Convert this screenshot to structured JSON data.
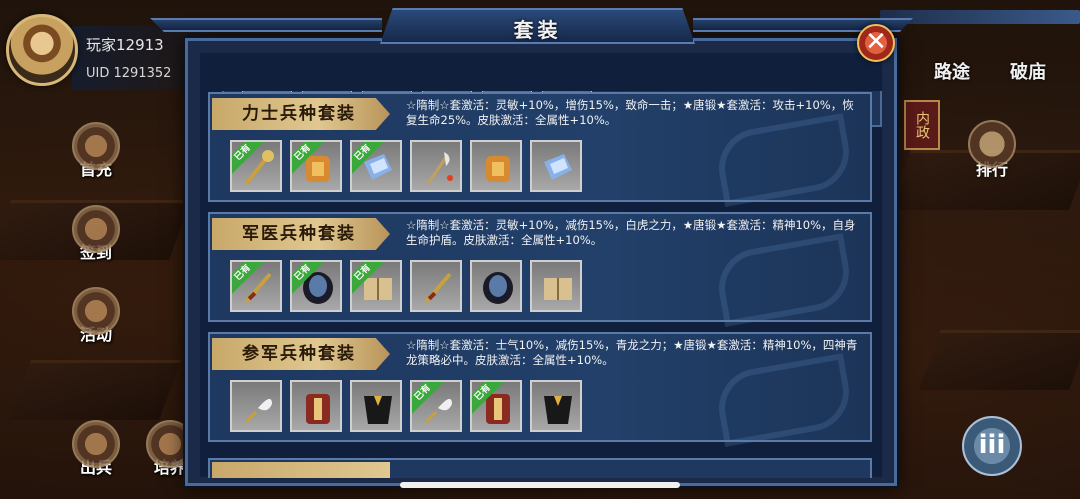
{
  "player": {
    "name": "玩家12913",
    "uid": "UID 1291352"
  },
  "left_menu": [
    {
      "label": "首充",
      "icon": "gift-icon"
    },
    {
      "label": "签到",
      "icon": "calendar-icon"
    },
    {
      "label": "活动",
      "icon": "event-icon"
    },
    {
      "label": "出兵",
      "icon": "army-icon"
    },
    {
      "label": "培养",
      "icon": "cultivate-icon"
    }
  ],
  "right_tabs": {
    "lutu": "路途",
    "pomiao": "破庙",
    "neizheng": "内政",
    "paihang": "排行",
    "menu": "iii"
  },
  "dialog": {
    "title": "套装",
    "close": "✕"
  },
  "owned_label": "已有",
  "sets": [
    {
      "name": "力士兵种套装",
      "desc": "☆隋制☆套激活：灵敏+10%，增伤15%，致命一击；★唐锻★套激活：攻击+10%，恢复生命25%。皮肤激活：全属性+10%。",
      "items": [
        {
          "icon": "mace-icon",
          "owned": true
        },
        {
          "icon": "armor-icon",
          "owned": true
        },
        {
          "icon": "scroll-icon",
          "owned": true
        },
        {
          "icon": "polearm-icon",
          "owned": false
        },
        {
          "icon": "armor-icon",
          "owned": false
        },
        {
          "icon": "scroll-icon",
          "owned": false
        }
      ]
    },
    {
      "name": "军医兵种套装",
      "desc": "☆隋制☆套激活：灵敏+10%，减伤15%，白虎之力，★唐锻★套激活：精神10%，自身生命护盾。皮肤激活：全属性+10%。",
      "items": [
        {
          "icon": "sword-icon",
          "owned": true
        },
        {
          "icon": "cloak-icon",
          "owned": true
        },
        {
          "icon": "book-icon",
          "owned": true
        },
        {
          "icon": "sword-icon",
          "owned": false
        },
        {
          "icon": "cloak-icon",
          "owned": false
        },
        {
          "icon": "book-icon",
          "owned": false
        }
      ]
    },
    {
      "name": "参军兵种套装",
      "desc": "☆隋制☆套激活：士气10%，减伤15%，青龙之力；★唐锻★套激活：精神10%，四神青龙策略必中。皮肤激活：全属性+10%。",
      "items": [
        {
          "icon": "feather-fan-icon",
          "owned": false
        },
        {
          "icon": "robe-icon",
          "owned": false
        },
        {
          "icon": "cape-icon",
          "owned": false
        },
        {
          "icon": "feather-fan-icon",
          "owned": true
        },
        {
          "icon": "robe-icon",
          "owned": true
        },
        {
          "icon": "cape-icon",
          "owned": false
        }
      ]
    }
  ],
  "colors": {
    "owned_badge": "#3aa83a",
    "name_tag": "#e0c890",
    "dialog_bg": "#10203c"
  }
}
